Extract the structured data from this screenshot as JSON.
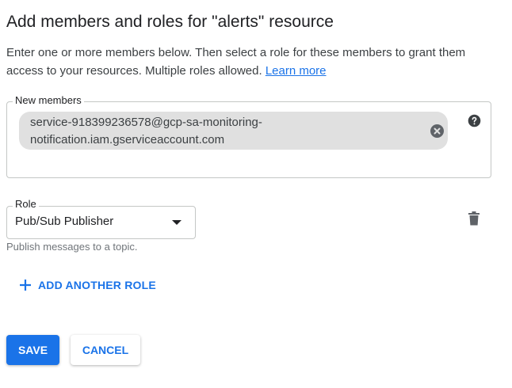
{
  "header": {
    "title": "Add members and roles for \"alerts\" resource"
  },
  "description": {
    "text": "Enter one or more members below. Then select a role for these members to grant them access to your resources. Multiple roles allowed. ",
    "link_label": "Learn more"
  },
  "members": {
    "label": "New members",
    "chips": [
      {
        "line1": "service-918399236578@gcp-sa-monitoring-",
        "line2": "notification.iam.gserviceaccount.com"
      }
    ],
    "help_icon": "help-icon",
    "remove_icon": "close-circle-icon"
  },
  "role": {
    "label": "Role",
    "selected": "Pub/Sub Publisher",
    "hint": "Publish messages to a topic.",
    "delete_icon": "trash-icon"
  },
  "actions": {
    "add_role_label": "ADD ANOTHER ROLE",
    "save_label": "SAVE",
    "cancel_label": "CANCEL"
  },
  "colors": {
    "accent": "#1a73e8",
    "chip_bg": "#e0e0e0",
    "border": "#c4c7c5",
    "icon": "#5f6368"
  }
}
